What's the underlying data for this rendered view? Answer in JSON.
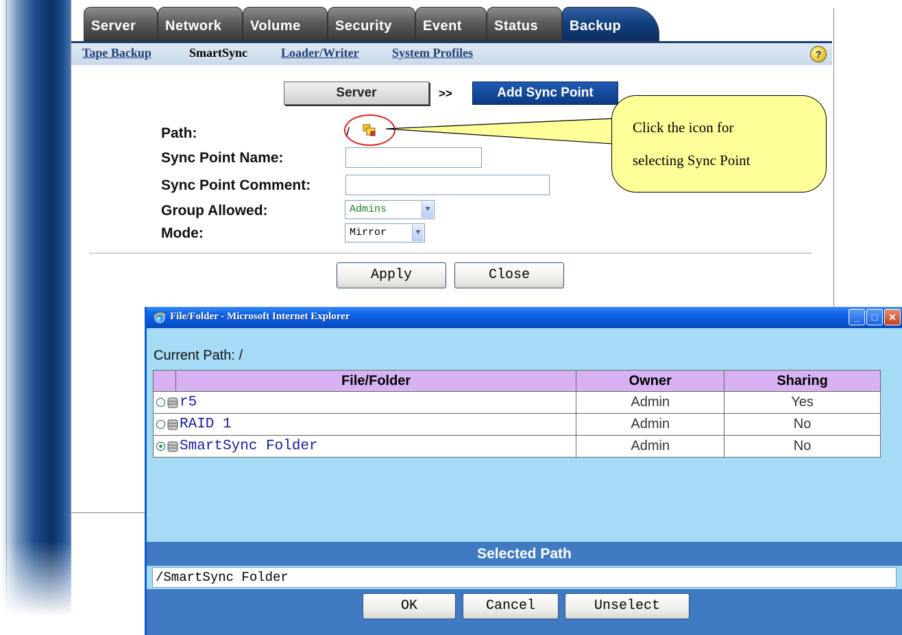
{
  "tabs": [
    "Server",
    "Network",
    "Volume",
    "Security",
    "Event",
    "Status",
    "Backup"
  ],
  "active_tab": "Backup",
  "subnav": [
    "Tape Backup",
    "SmartSync",
    "Loader/Writer",
    "System Profiles"
  ],
  "current_subnav": "SmartSync",
  "help_icon": "?",
  "steps": {
    "server": "Server",
    "separator": ">>",
    "add": "Add Sync Point"
  },
  "form": {
    "path_label": "Path:",
    "path_value": "/",
    "name_label": "Sync Point Name:",
    "comment_label": "Sync Point Comment:",
    "group_label": "Group Allowed:",
    "group_value": "Admins",
    "mode_label": "Mode:",
    "mode_value": "Mirror",
    "apply": "Apply",
    "close": "Close"
  },
  "callout": {
    "line1": "Click the icon for",
    "line2": "selecting Sync Point"
  },
  "popup": {
    "title": "File/Folder - Microsoft Internet Explorer",
    "current_path_label": "Current Path: /",
    "columns": [
      "File/Folder",
      "Owner",
      "Sharing"
    ],
    "rows": [
      {
        "name": "r5",
        "owner": "Admin",
        "sharing": "Yes",
        "selected": false
      },
      {
        "name": "RAID 1",
        "owner": "Admin",
        "sharing": "No",
        "selected": false
      },
      {
        "name": "SmartSync Folder",
        "owner": "Admin",
        "sharing": "No",
        "selected": true
      }
    ],
    "selected_path_label": "Selected Path",
    "selected_path_value": "/SmartSync Folder",
    "ok": "OK",
    "cancel": "Cancel",
    "unselect": "Unselect"
  },
  "colors": {
    "accent": "#0d3b84",
    "callout_bg": "#ffff99",
    "popup_bg": "#a6dbf5",
    "header_purple": "#d6b2f2"
  }
}
